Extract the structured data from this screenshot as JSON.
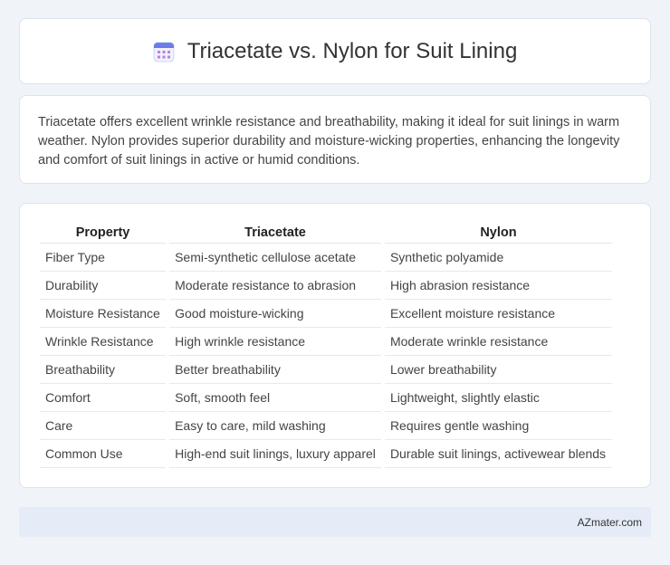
{
  "header": {
    "title": "Triacetate vs. Nylon for Suit Lining",
    "icon": "calendar-icon"
  },
  "summary": {
    "text": "Triacetate offers excellent wrinkle resistance and breathability, making it ideal for suit linings in warm weather. Nylon provides superior durability and moisture-wicking properties, enhancing the longevity and comfort of suit linings in active or humid conditions."
  },
  "table": {
    "headers": [
      "Property",
      "Triacetate",
      "Nylon"
    ],
    "rows": [
      [
        "Fiber Type",
        "Semi-synthetic cellulose acetate",
        "Synthetic polyamide"
      ],
      [
        "Durability",
        "Moderate resistance to abrasion",
        "High abrasion resistance"
      ],
      [
        "Moisture Resistance",
        "Good moisture-wicking",
        "Excellent moisture resistance"
      ],
      [
        "Wrinkle Resistance",
        "High wrinkle resistance",
        "Moderate wrinkle resistance"
      ],
      [
        "Breathability",
        "Better breathability",
        "Lower breathability"
      ],
      [
        "Comfort",
        "Soft, smooth feel",
        "Lightweight, slightly elastic"
      ],
      [
        "Care",
        "Easy to care, mild washing",
        "Requires gentle washing"
      ],
      [
        "Common Use",
        "High-end suit linings, luxury apparel",
        "Durable suit linings, activewear blends"
      ]
    ]
  },
  "footer": {
    "site": "AZmater.com"
  }
}
